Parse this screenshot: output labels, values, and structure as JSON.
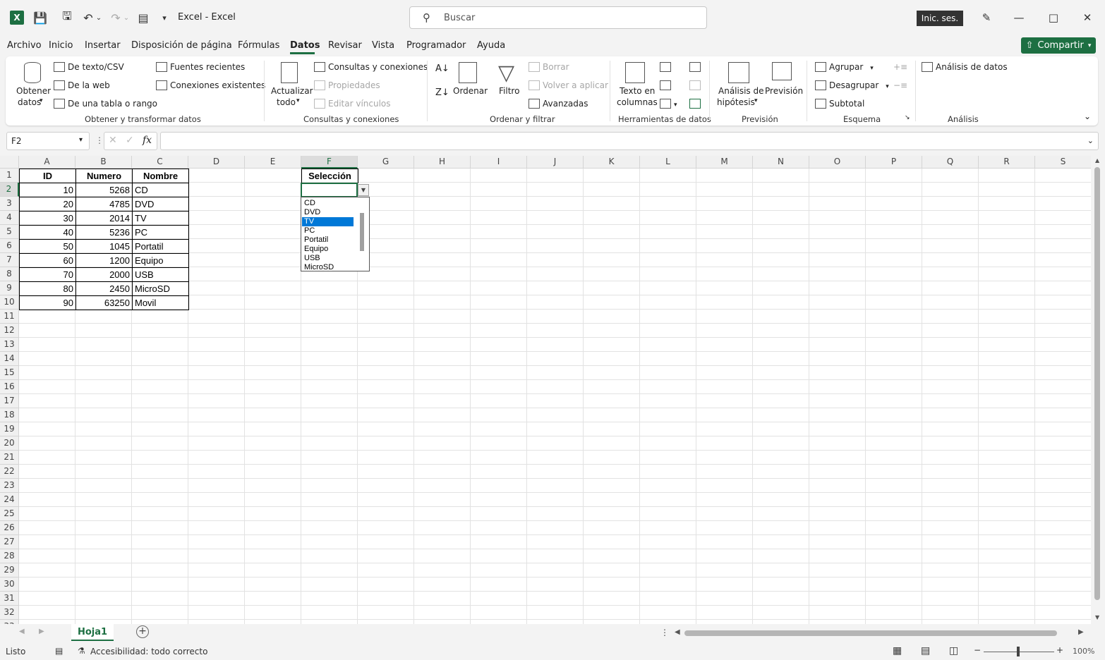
{
  "titlebar": {
    "app_title": "Excel  -  Excel",
    "search_placeholder": "Buscar",
    "signin_label": "Inic. ses."
  },
  "menu": {
    "items": [
      "Archivo",
      "Inicio",
      "Insertar",
      "Disposición de página",
      "Fórmulas",
      "Datos",
      "Revisar",
      "Vista",
      "Programador",
      "Ayuda"
    ],
    "active": "Datos",
    "share_label": "Compartir"
  },
  "ribbon": {
    "obtener": {
      "big_label_1": "Obtener",
      "big_label_2": "datos",
      "de_texto": "De texto/CSV",
      "de_web": "De la web",
      "de_tabla": "De una tabla o rango",
      "fuentes": "Fuentes recientes",
      "conexiones": "Conexiones existentes",
      "group": "Obtener y transformar datos"
    },
    "consultas": {
      "big_label_1": "Actualizar",
      "big_label_2": "todo",
      "consultas": "Consultas y conexiones",
      "propiedades": "Propiedades",
      "editar": "Editar vínculos",
      "group": "Consultas y conexiones"
    },
    "ordenar": {
      "ordenar": "Ordenar",
      "filtro": "Filtro",
      "borrar": "Borrar",
      "volver": "Volver a aplicar",
      "avanzadas": "Avanzadas",
      "group": "Ordenar y filtrar"
    },
    "herramientas": {
      "texto_1": "Texto en",
      "texto_2": "columnas",
      "group": "Herramientas de datos"
    },
    "prevision": {
      "analisis_1": "Análisis de",
      "analisis_2": "hipótesis",
      "prevision": "Previsión",
      "group": "Previsión"
    },
    "esquema": {
      "agrupar": "Agrupar",
      "desagrupar": "Desagrupar",
      "subtotal": "Subtotal",
      "group": "Esquema"
    },
    "analisis": {
      "analisis_datos": "Análisis de datos",
      "group": "Análisis"
    }
  },
  "formula_bar": {
    "name_box": "F2",
    "fx": "fx"
  },
  "columns": [
    "A",
    "B",
    "C",
    "D",
    "E",
    "F",
    "G",
    "H",
    "I",
    "J",
    "K",
    "L",
    "M",
    "N",
    "O",
    "P",
    "Q",
    "R",
    "S"
  ],
  "table": {
    "headers": [
      "ID",
      "Numero",
      "Nombre"
    ],
    "rows": [
      [
        "10",
        "5268",
        "CD"
      ],
      [
        "20",
        "4785",
        "DVD"
      ],
      [
        "30",
        "2014",
        "TV"
      ],
      [
        "40",
        "5236",
        "PC"
      ],
      [
        "50",
        "1045",
        "Portatil"
      ],
      [
        "60",
        "1200",
        "Equipo"
      ],
      [
        "70",
        "2000",
        "USB"
      ],
      [
        "80",
        "2450",
        "MicroSD"
      ],
      [
        "90",
        "63250",
        "Movil"
      ]
    ]
  },
  "selection": {
    "header": "Selección",
    "dropdown_options": [
      "CD",
      "DVD",
      "TV",
      "PC",
      "Portatil",
      "Equipo",
      "USB",
      "MicroSD"
    ],
    "highlighted": "TV"
  },
  "sheets": {
    "active": "Hoja1"
  },
  "status": {
    "ready": "Listo",
    "accessibility": "Accesibilidad: todo correcto",
    "zoom": "100%"
  },
  "colors": {
    "accent": "#1d6f42",
    "highlight": "#0078d7"
  }
}
